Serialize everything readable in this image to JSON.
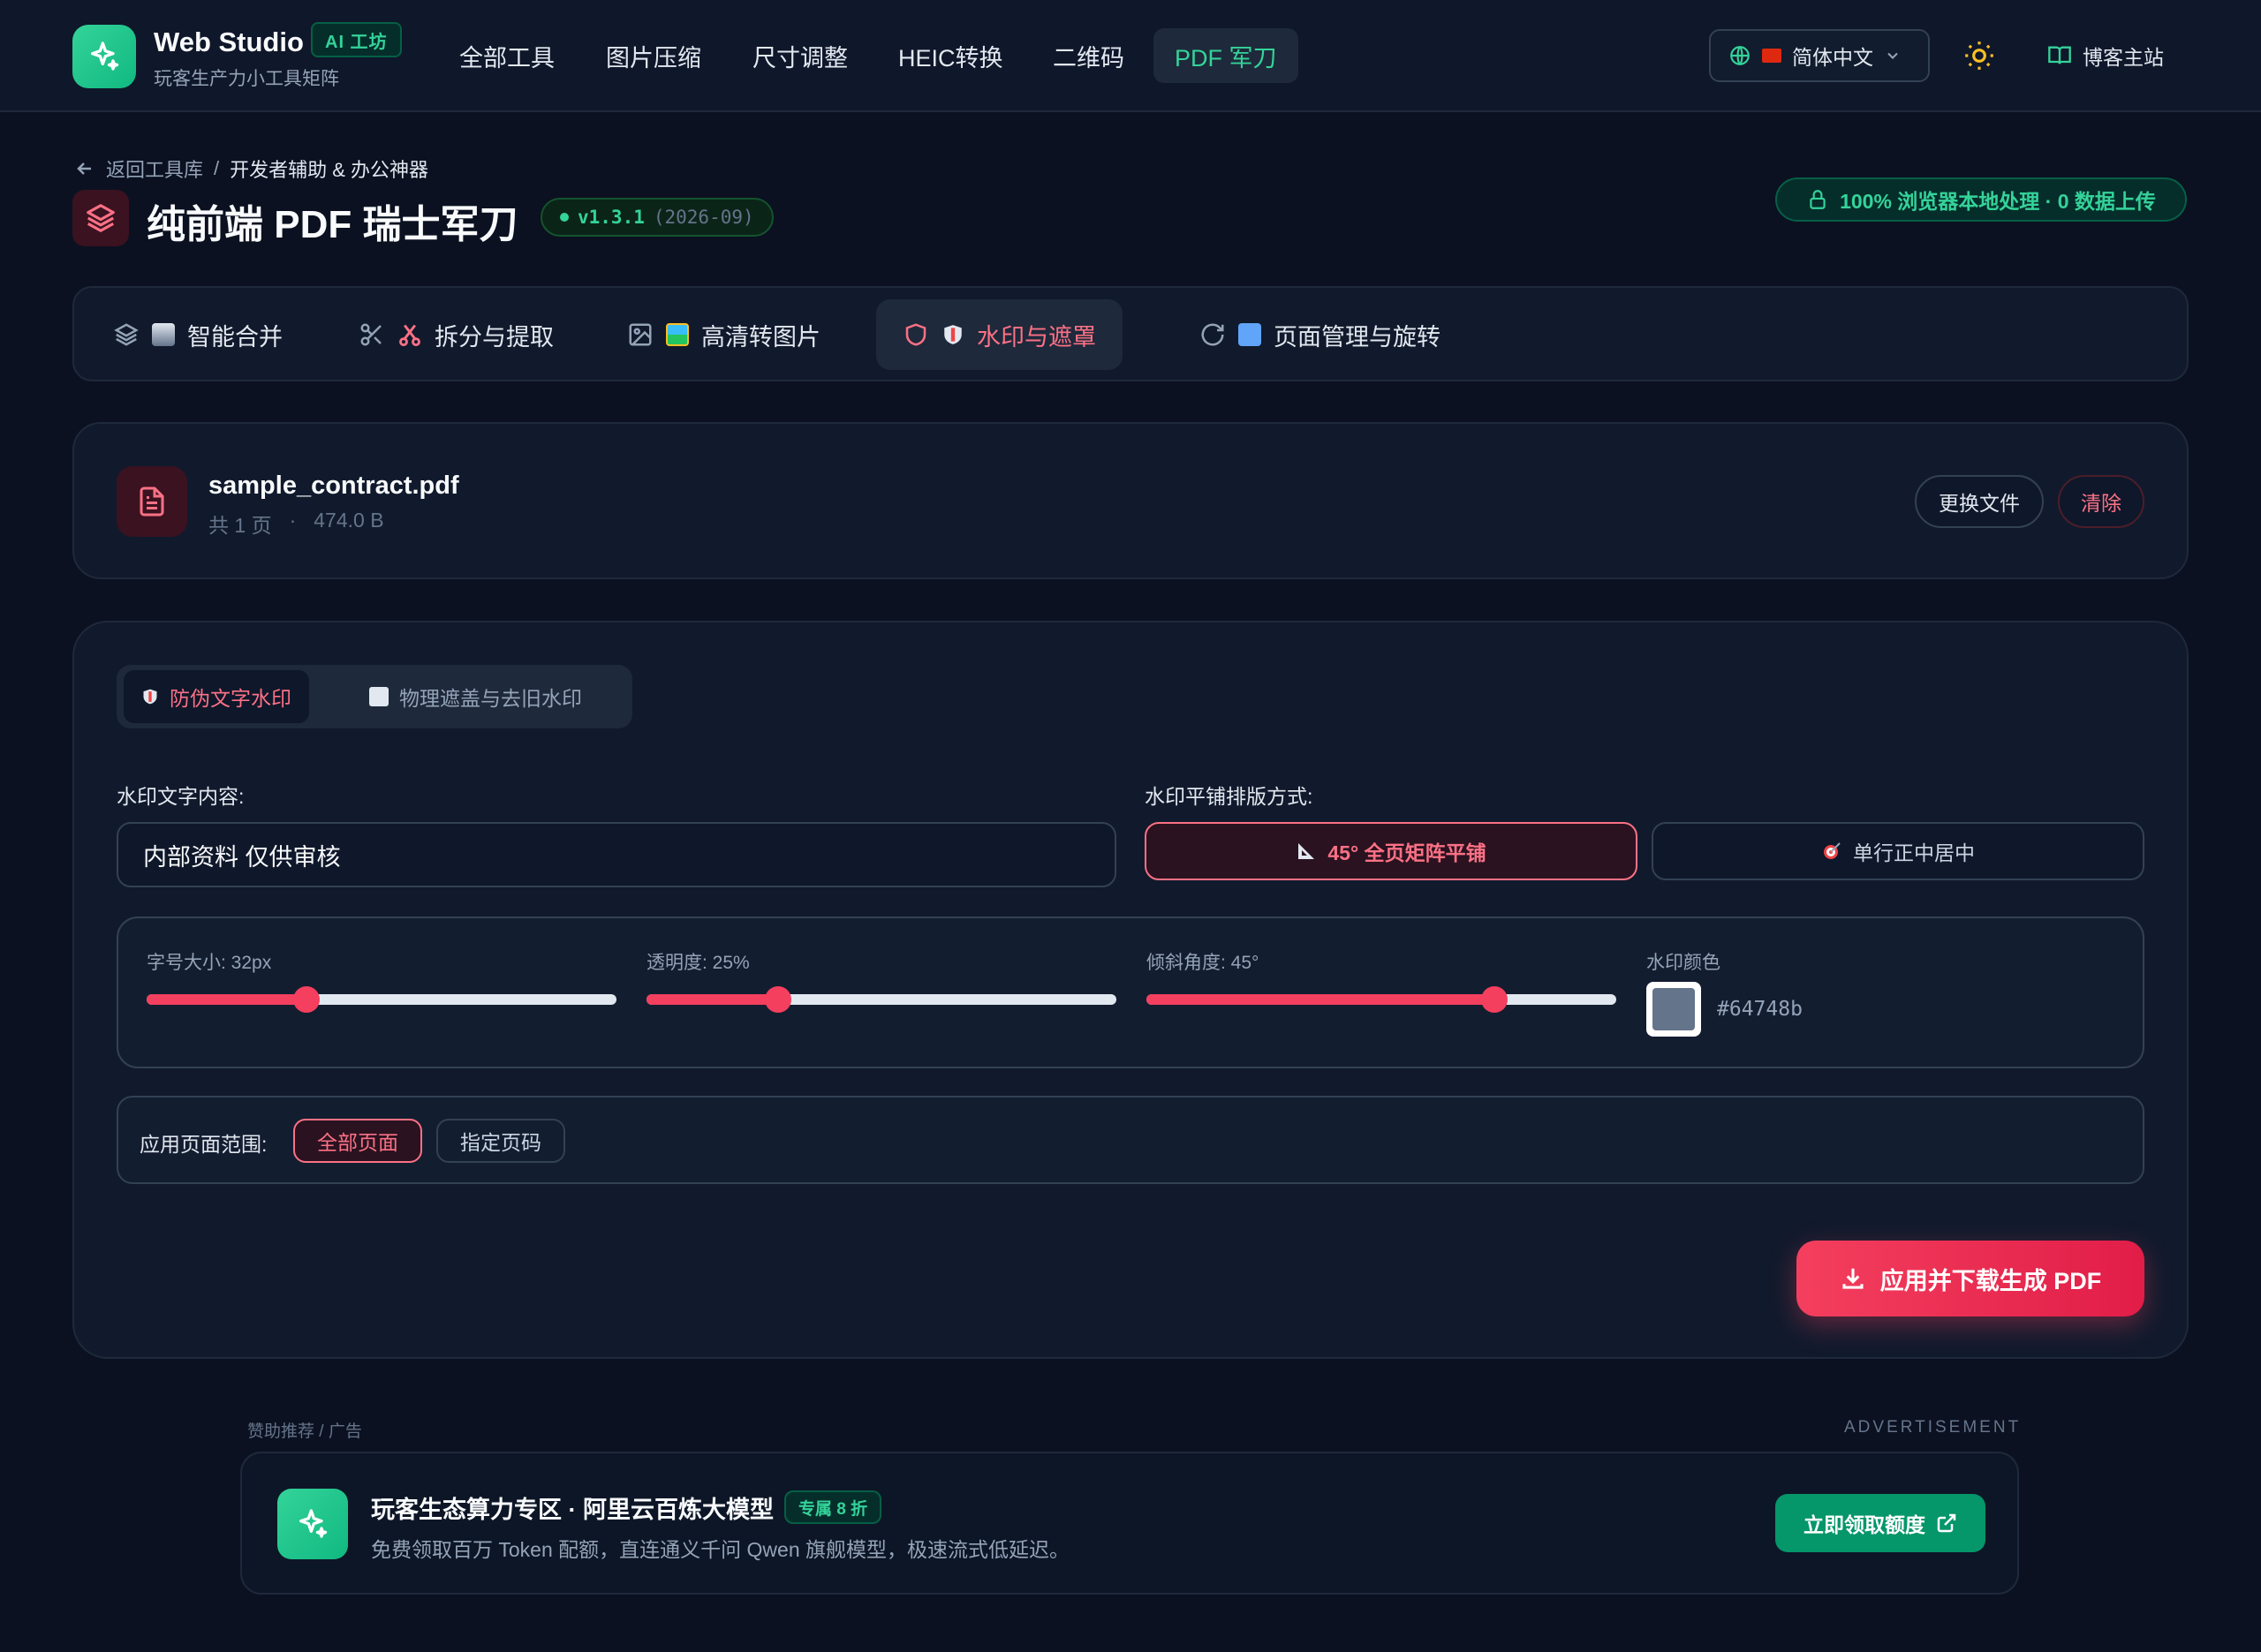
{
  "header": {
    "brand_title": "Web Studio",
    "ai_badge": "AI 工坊",
    "brand_sub": "玩客生产力小工具矩阵",
    "nav": [
      "全部工具",
      "图片压缩",
      "尺寸调整",
      "HEIC转换",
      "二维码",
      "PDF 军刀"
    ],
    "active_nav": "PDF 军刀",
    "language": "简体中文",
    "blog_link": "博客主站"
  },
  "breadcrumb": {
    "back": "返回工具库",
    "separator": "/",
    "current": "开发者辅助 & 办公神器"
  },
  "page": {
    "title": "纯前端 PDF 瑞士军刀",
    "version": "v1.3.1",
    "version_date": "(2026-09)",
    "privacy_badge": "100% 浏览器本地处理 · 0 数据上传"
  },
  "tabs": [
    {
      "label": "智能合并",
      "icon": "layers-icon"
    },
    {
      "label": "拆分与提取",
      "icon": "scissors-icon"
    },
    {
      "label": "高清转图片",
      "icon": "image-icon"
    },
    {
      "label": "水印与遮罩",
      "icon": "shield-icon"
    },
    {
      "label": "页面管理与旋转",
      "icon": "rotate-icon"
    }
  ],
  "active_tab": "水印与遮罩",
  "file": {
    "name": "sample_contract.pdf",
    "pages": "共 1 页",
    "dot": "·",
    "size": "474.0 B",
    "replace_label": "更换文件",
    "clear_label": "清除"
  },
  "watermark": {
    "subtabs": [
      "防伪文字水印",
      "物理遮盖与去旧水印"
    ],
    "active_subtab": "防伪文字水印",
    "text_label": "水印文字内容:",
    "text_value": "内部资料 仅供审核",
    "layout_label": "水印平铺排版方式:",
    "layout_options": [
      "45° 全页矩阵平铺",
      "单行正中居中"
    ],
    "active_layout": "45° 全页矩阵平铺",
    "font_size_label": "字号大小: 32px",
    "font_size_fraction": 0.34,
    "opacity_label": "透明度: 25%",
    "opacity_fraction": 0.28,
    "angle_label": "倾斜角度: 45°",
    "angle_fraction": 0.74,
    "color_label": "水印颜色",
    "color_hex": "#64748b",
    "range_label": "应用页面范围:",
    "range_options": [
      "全部页面",
      "指定页码"
    ],
    "active_range": "全部页面",
    "submit_label": "应用并下载生成 PDF"
  },
  "ad": {
    "tag_left": "赞助推荐 / 广告",
    "tag_right": "ADVERTISEMENT",
    "title": "玩客生态算力专区 · 阿里云百炼大模型",
    "badge": "专属 8 折",
    "desc": "免费领取百万 Token 配额，直连通义千问 Qwen 旗舰模型，极速流式低延迟。",
    "button": "立即领取额度"
  },
  "colors": {
    "accent": "#f43f5e",
    "brand": "#10b981",
    "background": "#0b1120"
  }
}
